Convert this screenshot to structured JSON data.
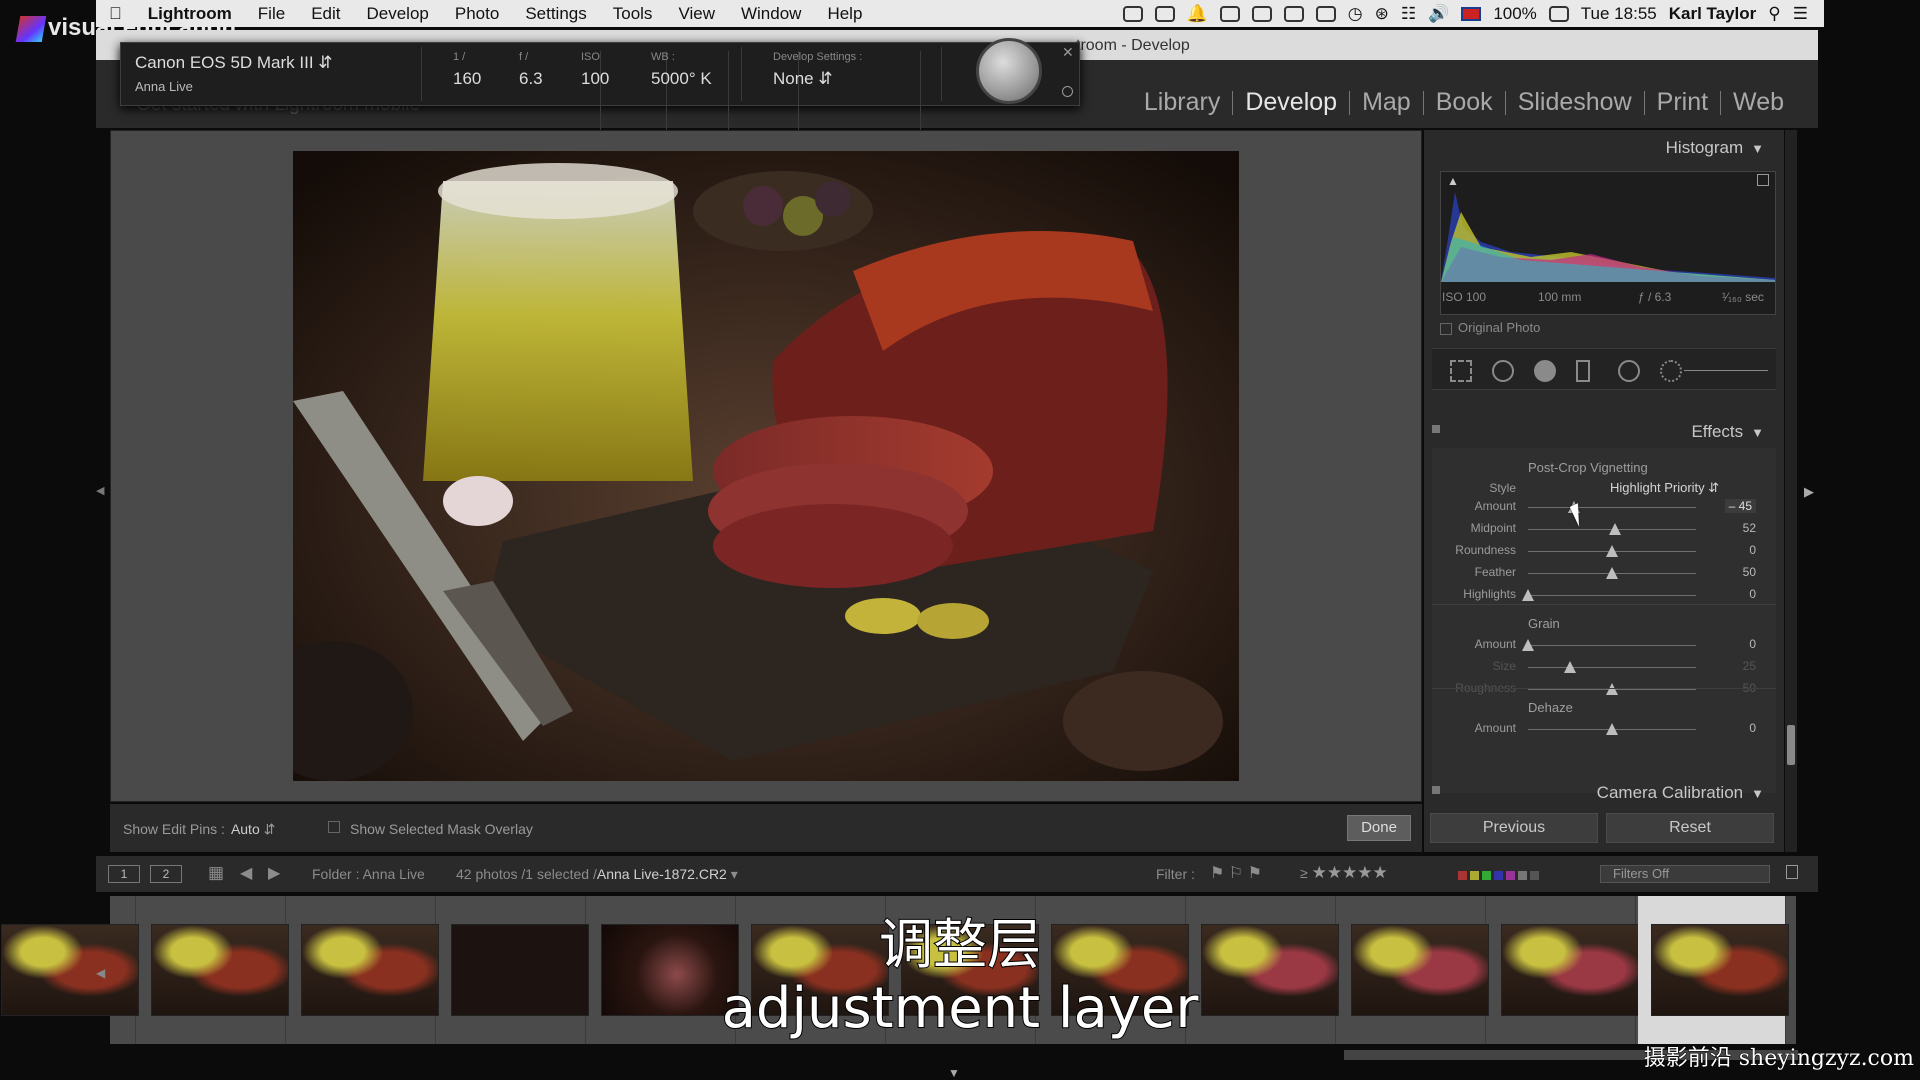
{
  "watermark_top": "visual education",
  "menubar": {
    "app": "Lightroom",
    "items": [
      "File",
      "Edit",
      "Develop",
      "Photo",
      "Settings",
      "Tools",
      "View",
      "Window",
      "Help"
    ],
    "battery": "100%",
    "clock": "Tue 18:55",
    "user": "Karl Taylor"
  },
  "window_title": "troom - Develop",
  "subtitle_bar": "Get started with Lightroom mobile",
  "modules": [
    "Library",
    "Develop",
    "Map",
    "Book",
    "Slideshow",
    "Print",
    "Web"
  ],
  "active_module": "Develop",
  "hud": {
    "camera": "Canon EOS 5D Mark III",
    "session": "Anna Live",
    "shutter_label": "1 /",
    "shutter": "160",
    "aperture_label": "f /",
    "aperture": "6.3",
    "iso_label": "ISO",
    "iso": "100",
    "wb_label": "WB :",
    "wb": "5000° K",
    "dev_label": "Develop Settings :",
    "dev": "None"
  },
  "toolbar": {
    "show_pins_label": "Show Edit Pins :",
    "show_pins_value": "Auto",
    "mask_overlay": "Show Selected Mask Overlay",
    "done": "Done"
  },
  "right_panel": {
    "histogram_title": "Histogram",
    "hist_info": {
      "iso": "ISO 100",
      "focal": "100 mm",
      "aperture": "ƒ / 6.3",
      "shutter": "¹⁄₁₆₀ sec"
    },
    "original_photo": "Original Photo",
    "effects_title": "Effects",
    "vignette_title": "Post-Crop Vignetting",
    "style_label": "Style",
    "style_value": "Highlight Priority",
    "vignette": [
      {
        "label": "Amount",
        "value": "– 45",
        "pos": 0.275
      },
      {
        "label": "Midpoint",
        "value": "52",
        "pos": 0.52
      },
      {
        "label": "Roundness",
        "value": "0",
        "pos": 0.5
      },
      {
        "label": "Feather",
        "value": "50",
        "pos": 0.5
      },
      {
        "label": "Highlights",
        "value": "0",
        "pos": 0.0
      }
    ],
    "grain_title": "Grain",
    "grain": [
      {
        "label": "Amount",
        "value": "0",
        "pos": 0.0
      },
      {
        "label": "Size",
        "value": "25",
        "pos": 0.25
      },
      {
        "label": "Roughness",
        "value": "50",
        "pos": 0.5
      }
    ],
    "dehaze_title": "Dehaze",
    "dehaze": [
      {
        "label": "Amount",
        "value": "0",
        "pos": 0.5
      }
    ],
    "calibration_title": "Camera Calibration",
    "previous": "Previous",
    "reset": "Reset"
  },
  "filmstrip_nav": {
    "view1": "1",
    "view2": "2",
    "folder": "Folder : Anna Live",
    "count": "42 photos /1 selected /",
    "filename": "Anna Live-1872.CR2",
    "filter_label": "Filter :",
    "filters_off": "Filters Off"
  },
  "subtitles": {
    "cn": "调整层",
    "en": "adjustment layer"
  },
  "watermark_bottom": "摄影前沿 sheyingzyz.com"
}
